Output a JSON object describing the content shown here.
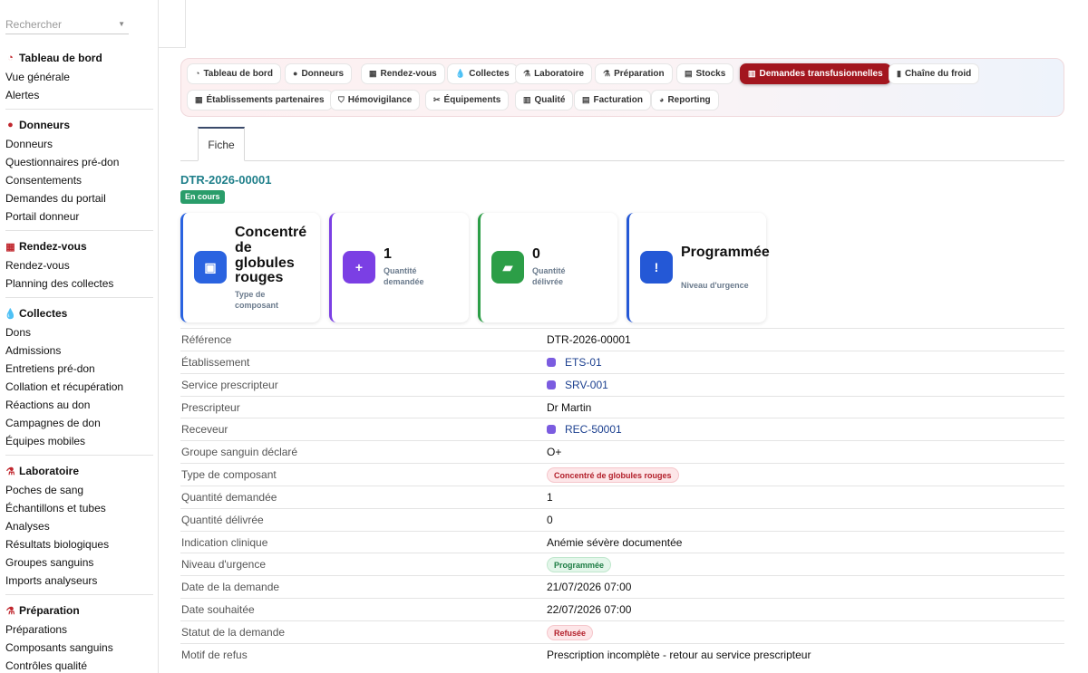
{
  "sidebar": {
    "search_placeholder": "Rechercher",
    "groups": [
      {
        "title": "Tableau de bord",
        "icon": "gauge-icon",
        "items": [
          "Vue générale",
          "Alertes"
        ]
      },
      {
        "title": "Donneurs",
        "icon": "user-icon",
        "items": [
          "Donneurs",
          "Questionnaires pré-don",
          "Consentements",
          "Demandes du portail",
          "Portail donneur"
        ]
      },
      {
        "title": "Rendez-vous",
        "icon": "calendar-icon",
        "items": [
          "Rendez-vous",
          "Planning des collectes"
        ]
      },
      {
        "title": "Collectes",
        "icon": "drop-icon",
        "items": [
          "Dons",
          "Admissions",
          "Entretiens pré-don",
          "Collation et récupération",
          "Réactions au don",
          "Campagnes de don",
          "Équipes mobiles"
        ]
      },
      {
        "title": "Laboratoire",
        "icon": "microscope-icon",
        "items": [
          "Poches de sang",
          "Échantillons et tubes",
          "Analyses",
          "Résultats biologiques",
          "Groupes sanguins",
          "Imports analyseurs"
        ]
      },
      {
        "title": "Préparation",
        "icon": "flask-icon",
        "items": [
          "Préparations",
          "Composants sanguins",
          "Contrôles qualité"
        ]
      }
    ]
  },
  "nav": {
    "row1": [
      {
        "label": "Tableau de bord",
        "icon": "gauge-icon"
      },
      {
        "label": "Donneurs",
        "icon": "user-icon"
      },
      {
        "label": "Rendez-vous",
        "icon": "calendar-icon"
      },
      {
        "label": "Collectes",
        "icon": "drop-icon"
      },
      {
        "label": "Laboratoire",
        "icon": "microscope-icon"
      },
      {
        "label": "Préparation",
        "icon": "flask-icon"
      },
      {
        "label": "Stocks",
        "icon": "warehouse-icon"
      },
      {
        "label": "Demandes transfusionnelles",
        "icon": "document-icon",
        "active": true
      },
      {
        "label": "Chaîne du froid",
        "icon": "thermometer-icon"
      }
    ],
    "row2": [
      {
        "label": "Établissements partenaires",
        "icon": "building-icon"
      },
      {
        "label": "Hémovigilance",
        "icon": "shield-icon"
      },
      {
        "label": "Équipements",
        "icon": "tools-icon"
      },
      {
        "label": "Qualité",
        "icon": "clipboard-icon"
      },
      {
        "label": "Facturation",
        "icon": "invoice-icon"
      },
      {
        "label": "Reporting",
        "icon": "chart-pie-icon"
      }
    ]
  },
  "tabs": {
    "fiche": "Fiche"
  },
  "record": {
    "id": "DTR-2026-00001",
    "status": "En cours"
  },
  "cards": [
    {
      "value": "Concentré de globules rouges",
      "label": "Type de composant",
      "icon": "box-icon",
      "color": "#2a63e0"
    },
    {
      "value": "1",
      "label": "Quantité demandée",
      "icon": "document-plus-icon",
      "color": "#7b3fe4"
    },
    {
      "value": "0",
      "label": "Quantité délivrée",
      "icon": "truck-icon",
      "color": "#2c9e47"
    },
    {
      "value": "Programmée",
      "label": "Niveau d'urgence",
      "icon": "alert-circle-icon",
      "color": "#2458d6"
    }
  ],
  "fields": [
    {
      "key": "Référence",
      "value": "DTR-2026-00001"
    },
    {
      "key": "Établissement",
      "value": "ETS-01",
      "link": true
    },
    {
      "key": "Service prescripteur",
      "value": "SRV-001",
      "link": true
    },
    {
      "key": "Prescripteur",
      "value": "Dr Martin"
    },
    {
      "key": "Receveur",
      "value": "REC-50001",
      "link": true
    },
    {
      "key": "Groupe sanguin déclaré",
      "value": "O+"
    },
    {
      "key": "Type de composant",
      "value": "Concentré de globules rouges",
      "badge": "red"
    },
    {
      "key": "Quantité demandée",
      "value": "1"
    },
    {
      "key": "Quantité délivrée",
      "value": "0"
    },
    {
      "key": "Indication clinique",
      "value": "Anémie sévère documentée"
    },
    {
      "key": "Niveau d'urgence",
      "value": "Programmée",
      "badge": "green"
    },
    {
      "key": "Date de la demande",
      "value": "21/07/2026 07:00"
    },
    {
      "key": "Date souhaitée",
      "value": "22/07/2026 07:00"
    },
    {
      "key": "Statut de la demande",
      "value": "Refusée",
      "badge": "red"
    },
    {
      "key": "Motif de refus",
      "value": "Prescription incomplète - retour au service prescripteur"
    }
  ]
}
